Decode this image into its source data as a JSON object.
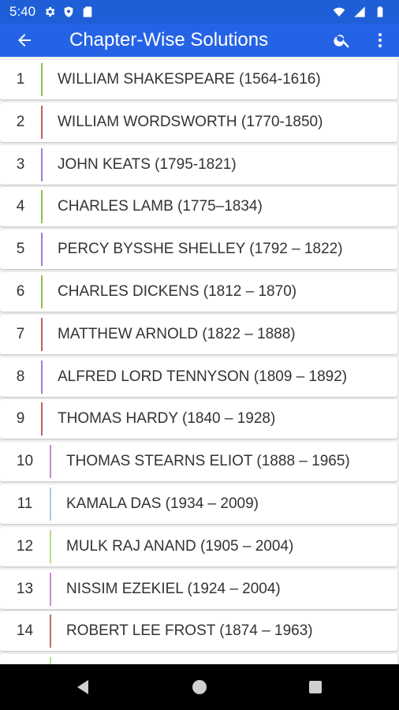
{
  "status_bar": {
    "time": "5:40",
    "left_icons": [
      "gear-icon",
      "shield-icon",
      "sd-card-icon"
    ],
    "right_icons": [
      "wifi-icon",
      "signal-icon",
      "battery-icon"
    ]
  },
  "app_bar": {
    "title": "Chapter-Wise Solutions",
    "back_icon": "arrow-left-icon",
    "search_icon": "search-icon",
    "menu_icon": "more-vert-icon",
    "color": "#2563e6"
  },
  "chapters": [
    {
      "number": "1",
      "title": "WILLIAM SHAKESPEARE (1564-1616)",
      "accent": "#8bc34a"
    },
    {
      "number": "2",
      "title": "WILLIAM WORDSWORTH (1770-1850)",
      "accent": "#c0605a"
    },
    {
      "number": "3",
      "title": "JOHN KEATS (1795-1821)",
      "accent": "#a57ad6"
    },
    {
      "number": "4",
      "title": "CHARLES LAMB (1775–1834)",
      "accent": "#8bc34a"
    },
    {
      "number": "5",
      "title": "PERCY BYSSHE SHELLEY (1792 – 1822)",
      "accent": "#a57ad6"
    },
    {
      "number": "6",
      "title": "CHARLES DICKENS (1812 – 1870)",
      "accent": "#8bc34a"
    },
    {
      "number": "7",
      "title": "MATTHEW ARNOLD (1822 – 1888)",
      "accent": "#c0605a"
    },
    {
      "number": "8",
      "title": "ALFRED LORD TENNYSON (1809 – 1892)",
      "accent": "#a57ad6"
    },
    {
      "number": "9",
      "title": "THOMAS HARDY (1840 – 1928)",
      "accent": "#c0605a"
    },
    {
      "number": "10",
      "title": "THOMAS STEARNS ELIOT (1888 – 1965)",
      "accent": "#c78ad0"
    },
    {
      "number": "11",
      "title": "KAMALA DAS (1934 – 2009)",
      "accent": "#a9cce8"
    },
    {
      "number": "12",
      "title": "MULK RAJ ANAND (1905 – 2004)",
      "accent": "#b8dc8a"
    },
    {
      "number": "13",
      "title": "NISSIM EZEKIEL (1924 – 2004)",
      "accent": "#c78ad0"
    },
    {
      "number": "14",
      "title": "ROBERT LEE FROST (1874 – 1963)",
      "accent": "#c07068"
    },
    {
      "number": "",
      "title": "",
      "accent": "#b8dc8a"
    }
  ],
  "nav_bar": {
    "back_icon": "triangle-back-icon",
    "home_icon": "circle-home-icon",
    "recents_icon": "square-recents-icon"
  }
}
